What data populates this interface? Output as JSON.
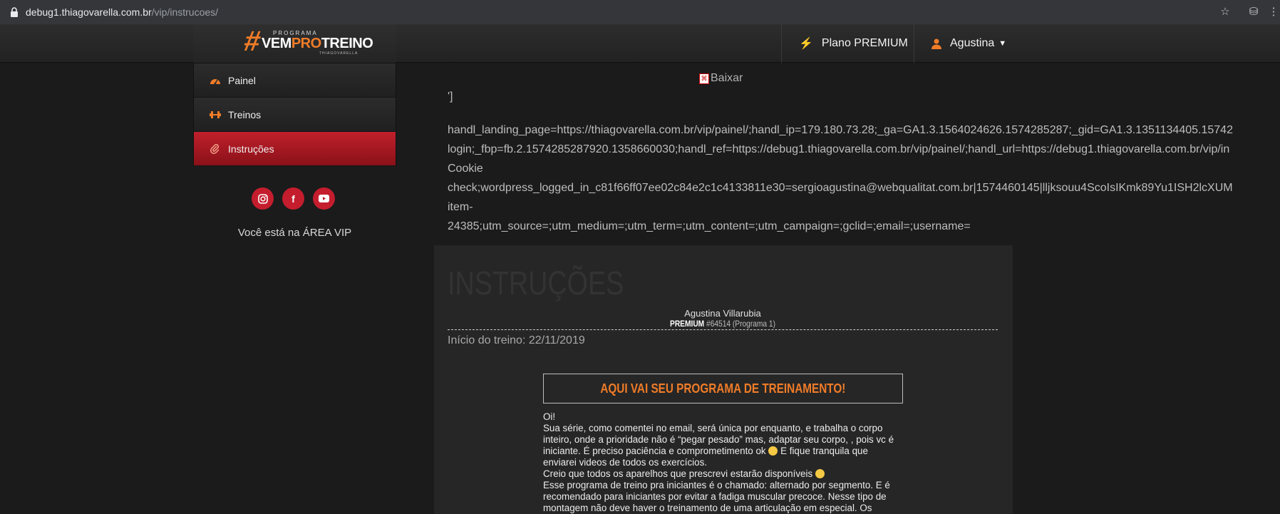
{
  "browser": {
    "url_domain": "debug1.thiagovarella.com.br",
    "url_path": "/vip/instrucoes/"
  },
  "logo": {
    "prefix": "PROGRAMA",
    "brand_a": "VEM",
    "brand_b": "PRO",
    "brand_c": "TREINO",
    "tagline": "THIAGOVARELLA"
  },
  "header": {
    "plan_label": "Plano PREMIUM",
    "user_label": "Agustina"
  },
  "sidebar": {
    "items": [
      {
        "label": "Painel"
      },
      {
        "label": "Treinos"
      },
      {
        "label": "Instruções"
      }
    ]
  },
  "vip_text": "Você está na ÁREA VIP",
  "download_label": "Baixar",
  "bracket_text": "']",
  "debug_lines": [
    "handl_landing_page=https://thiagovarella.com.br/vip/painel/;handl_ip=179.180.73.28;_ga=GA1.3.1564024626.1574285287;_gid=GA1.3.1351134405.15742",
    "login;_fbp=fb.2.1574285287920.1358660030;handl_ref=https://debug1.thiagovarella.com.br/vip/painel/;handl_url=https://debug1.thiagovarella.com.br/vip/in",
    "Cookie",
    "check;wordpress_logged_in_c81f66ff07ee02c84e2c1c4133811e30=sergioagustina@webqualitat.com.br|1574460145|lljksouu4ScoIsIKmk89Yu1ISH2lcXUM",
    "item-",
    "24385;utm_source=;utm_medium=;utm_term=;utm_content=;utm_campaign=;gclid=;email=;username="
  ],
  "main": {
    "title": "INSTRUÇÕES",
    "user_name": "Agustina Villarubia",
    "plan_badge": "PREMIUM",
    "plan_detail": "#64514 (Programa 1)",
    "start_date": "Início do treino: 22/11/2019",
    "program_heading": "AQUI VAI SEU PROGRAMA DE TREINAMENTO!",
    "message": {
      "greeting": "Oi!",
      "p1a": "Sua série, como comentei no email, será única por enquanto, e trabalha o corpo inteiro, onde a prioridade não é “pegar pesado” mas, adaptar seu corpo, , pois vc é iniciante. É preciso paciência e comprometimento ok",
      "p1b": "E fique tranquila que enviarei videos de todos os exercícios.",
      "p2": "Creio que todos os aparelhos que prescrevi estarão disponíveis",
      "p3": "Esse programa de treino pra iniciantes é o chamado: alternado por segmento. E é recomendado para iniciantes por evitar a fadiga muscular precoce. Nesse tipo de montagem não deve haver o treinamento de uma articulação em especial. Os"
    }
  },
  "colors": {
    "accent": "#f07c28",
    "active_red": "#c0202b",
    "background": "#1b1b1b"
  },
  "icons": {
    "painel": "dashboard-icon",
    "treinos": "dumbbell-icon",
    "instrucoes": "paperclip-icon",
    "plan": "bolt-icon",
    "user": "user-icon"
  }
}
